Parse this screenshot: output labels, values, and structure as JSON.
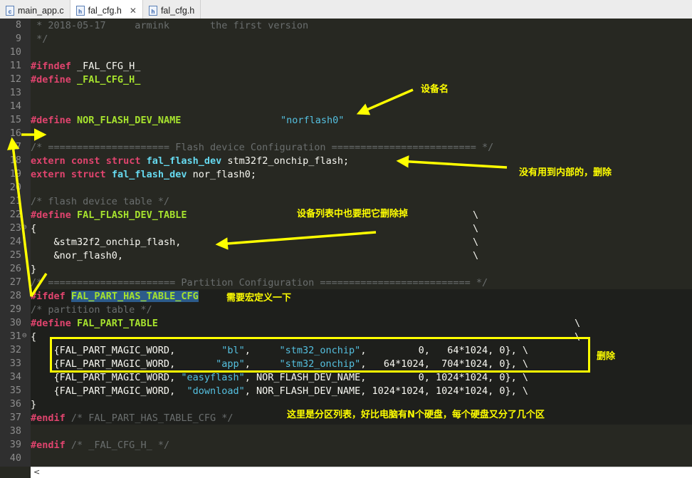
{
  "tabs": [
    {
      "icon": "c",
      "label": "main_app.c",
      "active": false,
      "closable": false
    },
    {
      "icon": "h",
      "label": "fal_cfg.h",
      "active": true,
      "closable": true
    },
    {
      "icon": "h",
      "label": "fal_cfg.h",
      "active": false,
      "closable": false
    }
  ],
  "line_numbers": [
    "8",
    "9",
    "10",
    "11",
    "12",
    "13",
    "14",
    "15",
    "16",
    "17",
    "18",
    "19",
    "20",
    "21",
    "22",
    "23",
    "24",
    "25",
    "26",
    "27",
    "28",
    "29",
    "30",
    "31",
    "32",
    "33",
    "34",
    "35",
    "36",
    "37",
    "38",
    "39",
    "40"
  ],
  "code": {
    "l8": " * 2018-05-17     armink       the first version",
    "l9": " */",
    "l11_a": "#ifndef",
    "l11_b": " _FAL_CFG_H_",
    "l12_a": "#define",
    "l12_b": " _FAL_CFG_H_",
    "l15_a": "#define",
    "l15_b": " NOR_FLASH_DEV_NAME",
    "l15_c": "\"norflash0\"",
    "l17": "/* ===================== Flash device Configuration ========================= */",
    "l18_a": "extern",
    "l18_b": "const",
    "l18_c": "struct",
    "l18_d": "fal_flash_dev",
    "l18_e": " stm32f2_onchip_flash;",
    "l19_a": "extern",
    "l19_b": "struct",
    "l19_c": "fal_flash_dev",
    "l19_d": " nor_flash0;",
    "l21": "/* flash device table */",
    "l22_a": "#define",
    "l22_b": " FAL_FLASH_DEV_TABLE",
    "backslash": "\\",
    "l23": "{",
    "l24": "    &stm32f2_onchip_flash,",
    "l25": "    &nor_flash0,",
    "l26": "}",
    "l27": "/* ====================== Partition Configuration ========================== */",
    "l28_a": "#ifdef",
    "l28_b": "FAL_PART_HAS_TABLE_CFG",
    "l29": "/* partition table */",
    "l30_a": "#define",
    "l30_b": " FAL_PART_TABLE",
    "l31": "{",
    "l32_a": "    {FAL_PART_MAGIC_WORD,        ",
    "l32_b": "\"bl\"",
    "l32_c": ",     ",
    "l32_d": "\"stm32_onchip\"",
    "l32_e": ",         0,   64*1024, 0},",
    "l33_a": "    {FAL_PART_MAGIC_WORD,       ",
    "l33_b": "\"app\"",
    "l33_c": ",     ",
    "l33_d": "\"stm32_onchip\"",
    "l33_e": ",   64*1024,  704*1024, 0},",
    "l34_a": "    {FAL_PART_MAGIC_WORD, ",
    "l34_b": "\"easyflash\"",
    "l34_c": ", NOR_FLASH_DEV_NAME,         0, 1024*1024, 0},",
    "l35_a": "    {FAL_PART_MAGIC_WORD,  ",
    "l35_b": "\"download\"",
    "l35_c": ", NOR_FLASH_DEV_NAME, 1024*1024, 1024*1024, 0},",
    "l36": "}",
    "l37_a": "#endif",
    "l37_b": " /* FAL_PART_HAS_TABLE_CFG */",
    "l39_a": "#endif",
    "l39_b": " /* _FAL_CFG_H_ */"
  },
  "annotations": {
    "device_name": "设备名",
    "unused_delete": "没有用到内部的，删除",
    "table_delete": "设备列表中也要把它删除掉",
    "need_macro": "需要宏定义一下",
    "delete": "删除",
    "partition_note": "这里是分区列表，好比电脑有N个硬盘，每个硬盘又分了几个区"
  },
  "scrollbar": {
    "left_arrow": "<"
  },
  "colors": {
    "annotation": "#ffff00",
    "editor_bg": "#272822",
    "selection": "#2c5b8a"
  }
}
